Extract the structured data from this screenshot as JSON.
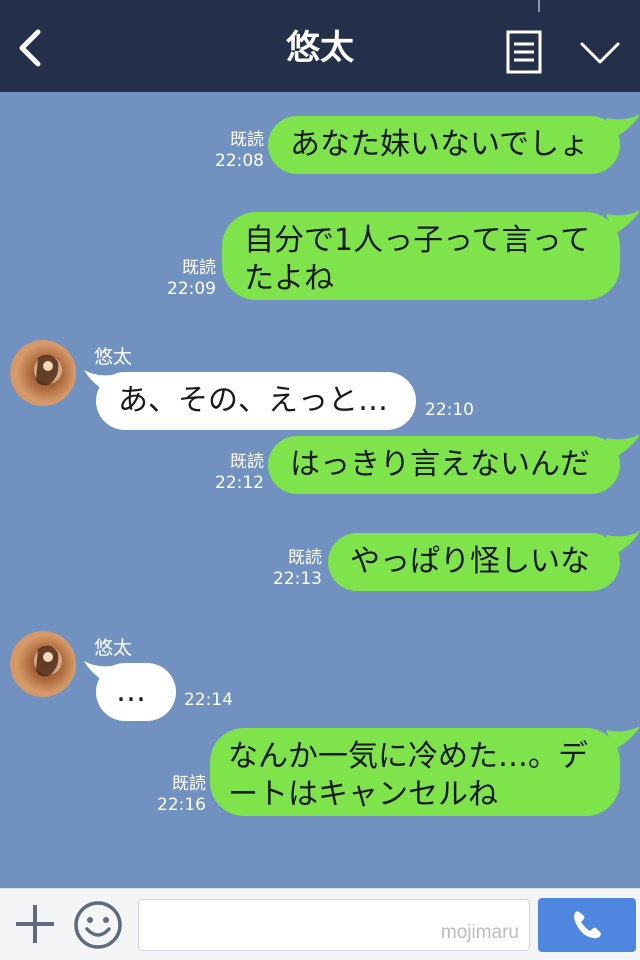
{
  "header": {
    "title": "悠太",
    "back_icon": "chevron-left-icon",
    "menu_icon": "notes-icon",
    "collapse_icon": "chevron-down-icon",
    "background": "#24304a"
  },
  "chat": {
    "background": "#7192c0",
    "sent_color": "#7fe34b",
    "received_color": "#ffffff",
    "messages": [
      {
        "from": "me",
        "text": "あなた妹いないでしょ",
        "read": "既読",
        "time": "22:08"
      },
      {
        "from": "me",
        "text": "自分で1人っ子って言って\nたよね",
        "read": "既読",
        "time": "22:09"
      },
      {
        "from": "悠太",
        "sender": "悠太",
        "text": "あ、その、えっと…",
        "time": "22:10"
      },
      {
        "from": "me",
        "text": "はっきり言えないんだ",
        "read": "既読",
        "time": "22:12"
      },
      {
        "from": "me",
        "text": "やっぱり怪しいな",
        "read": "既読",
        "time": "22:13"
      },
      {
        "from": "悠太",
        "sender": "悠太",
        "text": "…",
        "time": "22:14"
      },
      {
        "from": "me",
        "text": "なんか一気に冷めた…。デ\nートはキャンセルね",
        "read": "既読",
        "time": "22:16"
      }
    ]
  },
  "footer": {
    "plus_icon": "plus-icon",
    "emoji_icon": "smile-icon",
    "input_value": "",
    "watermark": "mojimaru",
    "call_icon": "phone-icon",
    "call_color": "#4f86e0"
  }
}
